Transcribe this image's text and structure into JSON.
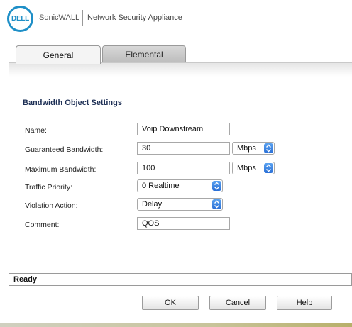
{
  "header": {
    "logo_text": "DELL",
    "brand": "SonicWALL",
    "product": "Network Security Appliance",
    "colors": {
      "logo": "#1e8fc7"
    }
  },
  "tabs": [
    {
      "label": "General",
      "active": true
    },
    {
      "label": "Elemental",
      "active": false
    }
  ],
  "section": {
    "title": "Bandwidth Object Settings"
  },
  "form": {
    "name": {
      "label": "Name:",
      "value": "Voip Downstream"
    },
    "guaranteed": {
      "label": "Guaranteed Bandwidth:",
      "value": "30",
      "unit": "Mbps"
    },
    "maximum": {
      "label": "Maximum Bandwidth:",
      "value": "100",
      "unit": "Mbps"
    },
    "priority": {
      "label": "Traffic Priority:",
      "value": "0 Realtime"
    },
    "violation": {
      "label": "Violation Action:",
      "value": "Delay"
    },
    "comment": {
      "label": "Comment:",
      "value": "QOS"
    }
  },
  "status": {
    "text": "Ready"
  },
  "buttons": {
    "ok": "OK",
    "cancel": "Cancel",
    "help": "Help"
  },
  "icons": {
    "select_arrows": "updown-chevron-icon"
  }
}
